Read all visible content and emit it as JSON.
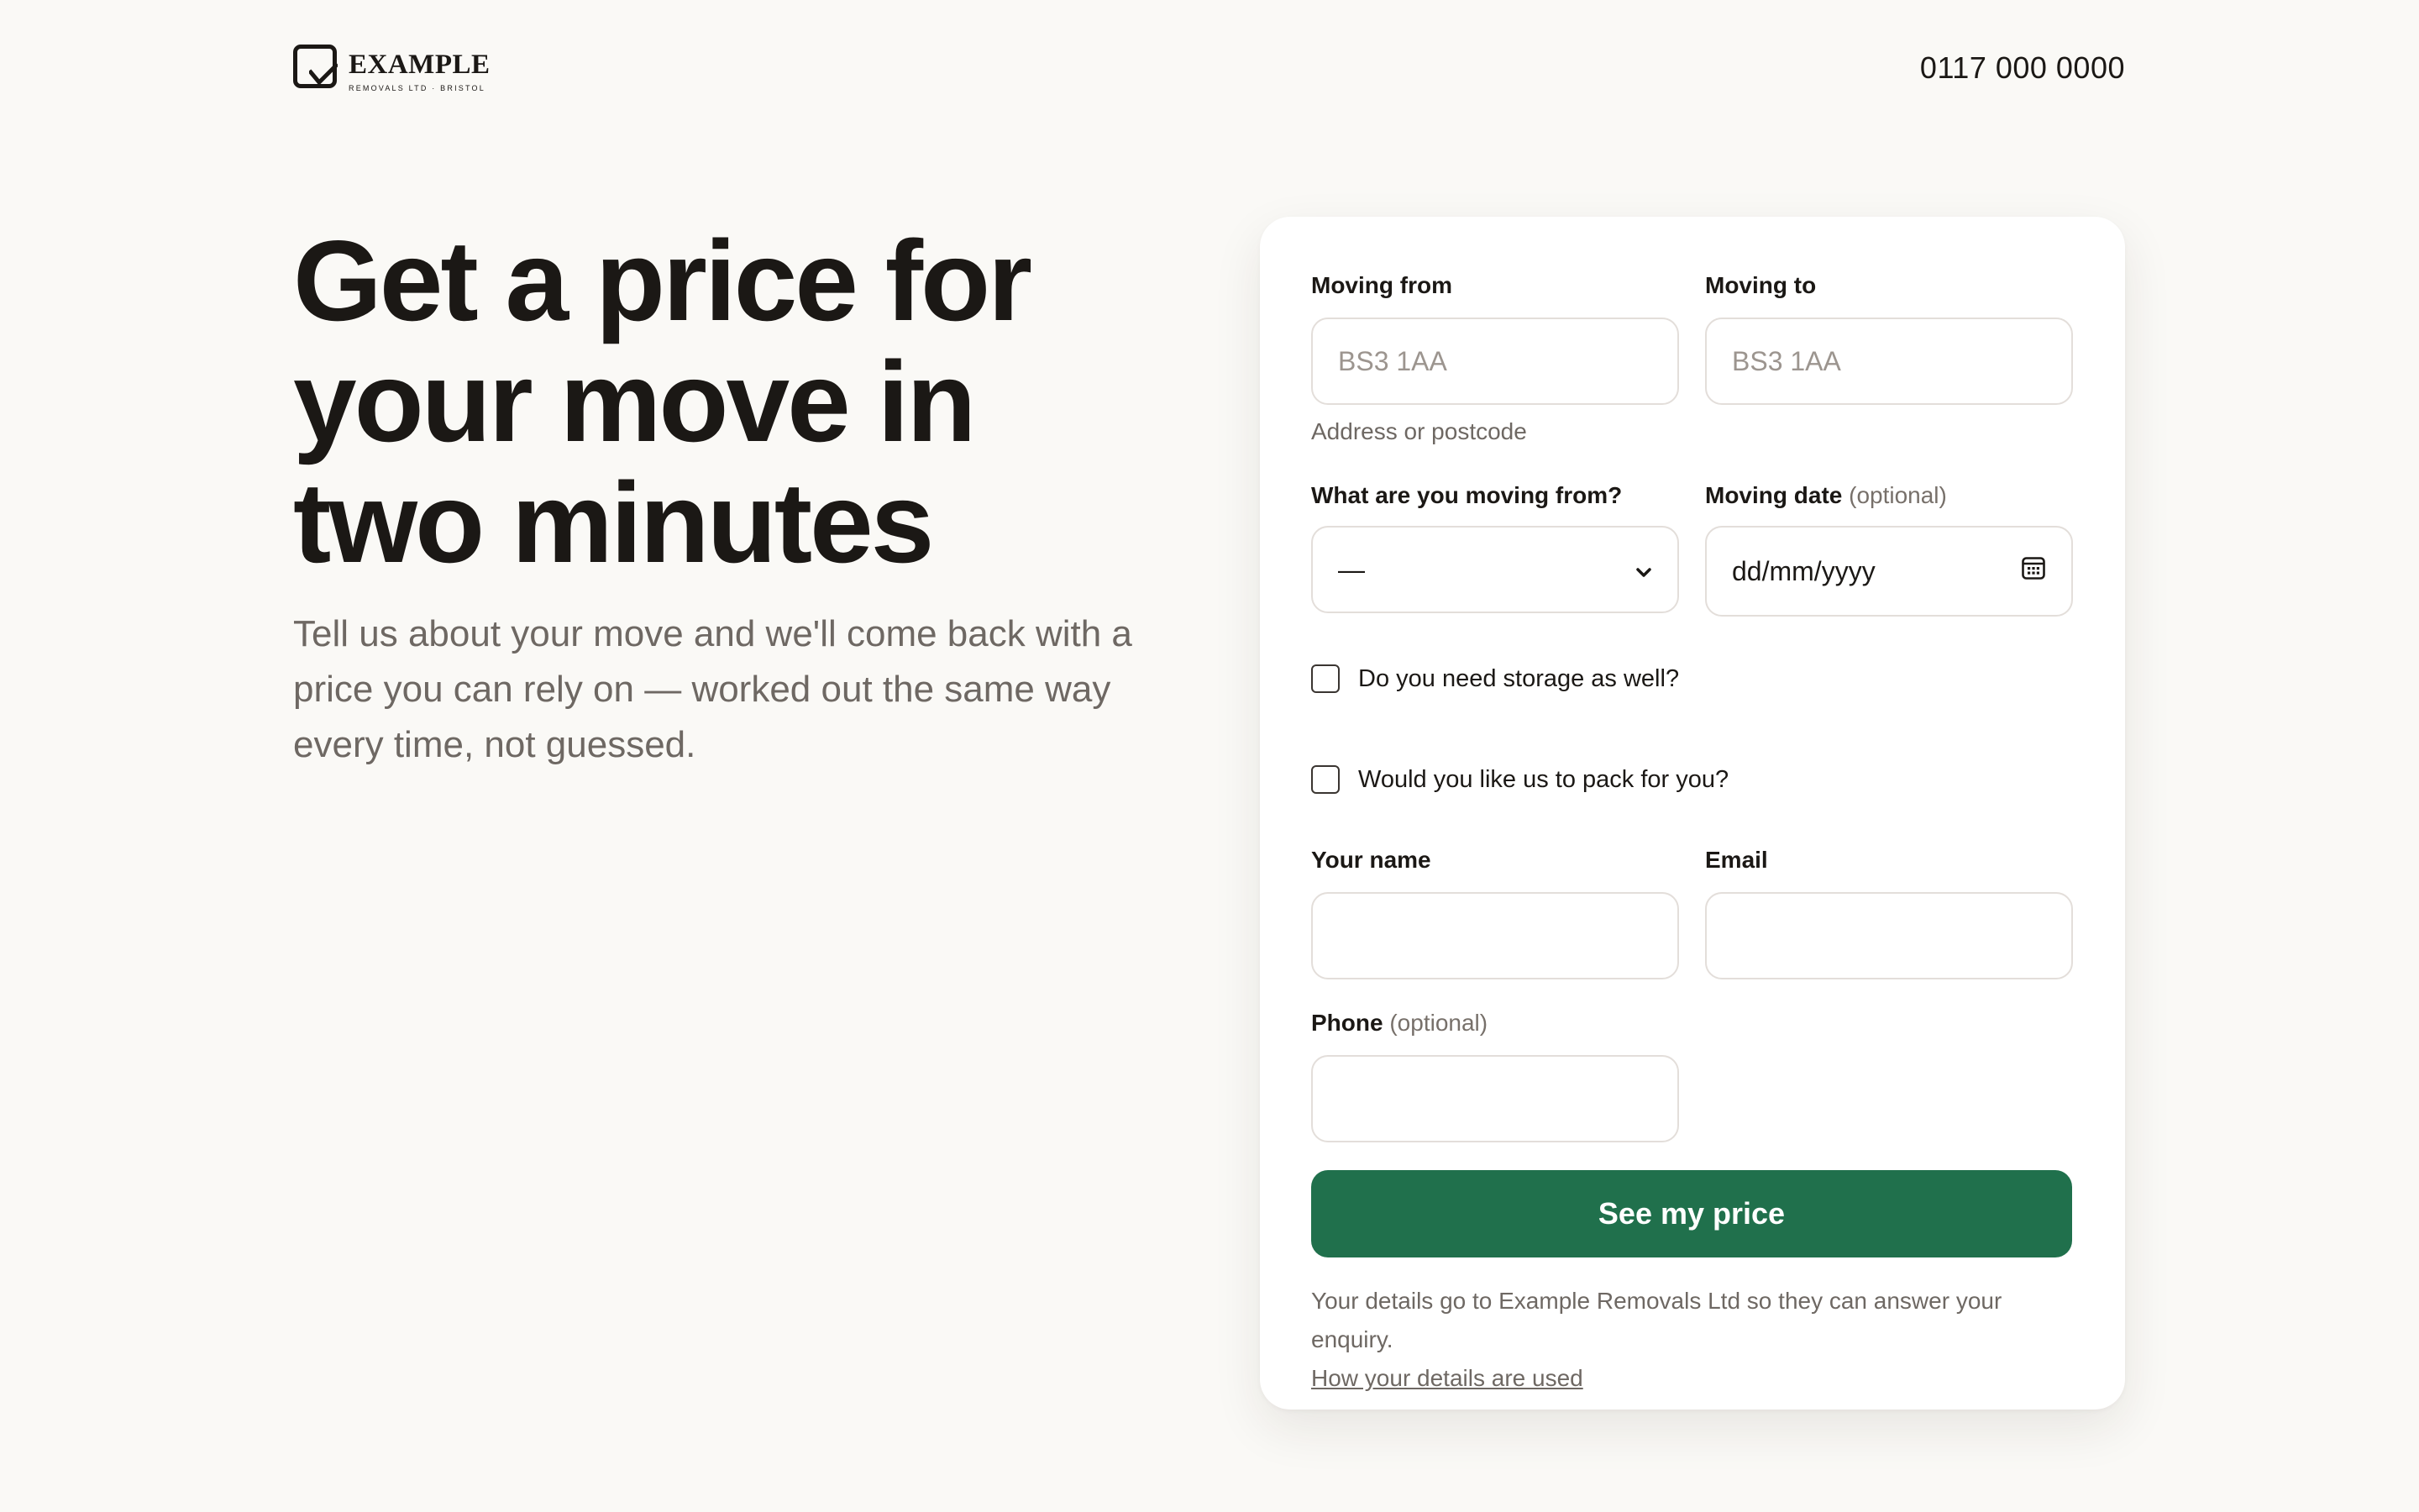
{
  "header": {
    "logo_word": "EXAMPLE",
    "logo_sub": "REMOVALS LTD · BRISTOL",
    "phone": "0117 000 0000"
  },
  "hero": {
    "title": "Get a price for your move in two minutes",
    "subtitle": "Tell us about your move and we'll come back with a price you can rely on — worked out the same way every time, not guessed."
  },
  "form": {
    "moving_from": {
      "label": "Moving from",
      "placeholder": "BS3 1AA"
    },
    "moving_to": {
      "label": "Moving to",
      "placeholder": "BS3 1AA"
    },
    "address_hint": "Address or postcode",
    "property_type": {
      "label": "What are you moving from?",
      "selected": "—"
    },
    "moving_date": {
      "label": "Moving date",
      "optional": "(optional)",
      "value": "dd/mm/yyyy",
      "icon": "calendar-icon"
    },
    "storage_checkbox": {
      "label": "Do you need storage as well?",
      "checked": false
    },
    "packing_checkbox": {
      "label": "Would you like us to pack for you?",
      "checked": false
    },
    "name": {
      "label": "Your name",
      "value": ""
    },
    "email": {
      "label": "Email",
      "value": ""
    },
    "phone": {
      "label": "Phone",
      "optional": "(optional)",
      "value": ""
    },
    "submit_label": "See my price",
    "footer_text": "Your details go to Example Removals Ltd so they can answer your enquiry.",
    "footer_link": "How your details are used"
  },
  "colors": {
    "page_background": "#faf9f6",
    "card_background": "#ffffff",
    "accent": "#20704c",
    "text_primary": "#1b1815",
    "text_muted": "#6e6863"
  }
}
